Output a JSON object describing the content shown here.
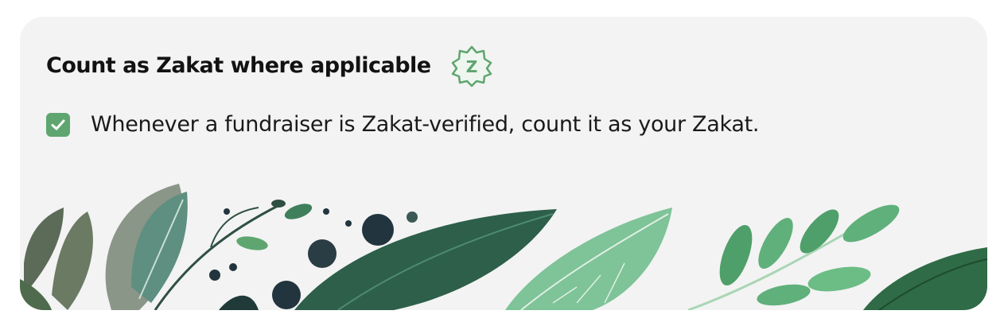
{
  "zakat": {
    "title": "Count as Zakat where applicable",
    "badge_letter": "Z",
    "checkbox_checked": true,
    "checkbox_label": "Whenever a fundraiser is Zakat-verified, count it as your Zakat."
  },
  "colors": {
    "accent_green": "#5fa56f",
    "card_background": "#f3f3f3",
    "dark_leaf": "#2d5f4b",
    "light_leaf": "#7fc398"
  },
  "icons": {
    "badge": "zakat-badge-icon",
    "check": "checkmark-icon"
  }
}
